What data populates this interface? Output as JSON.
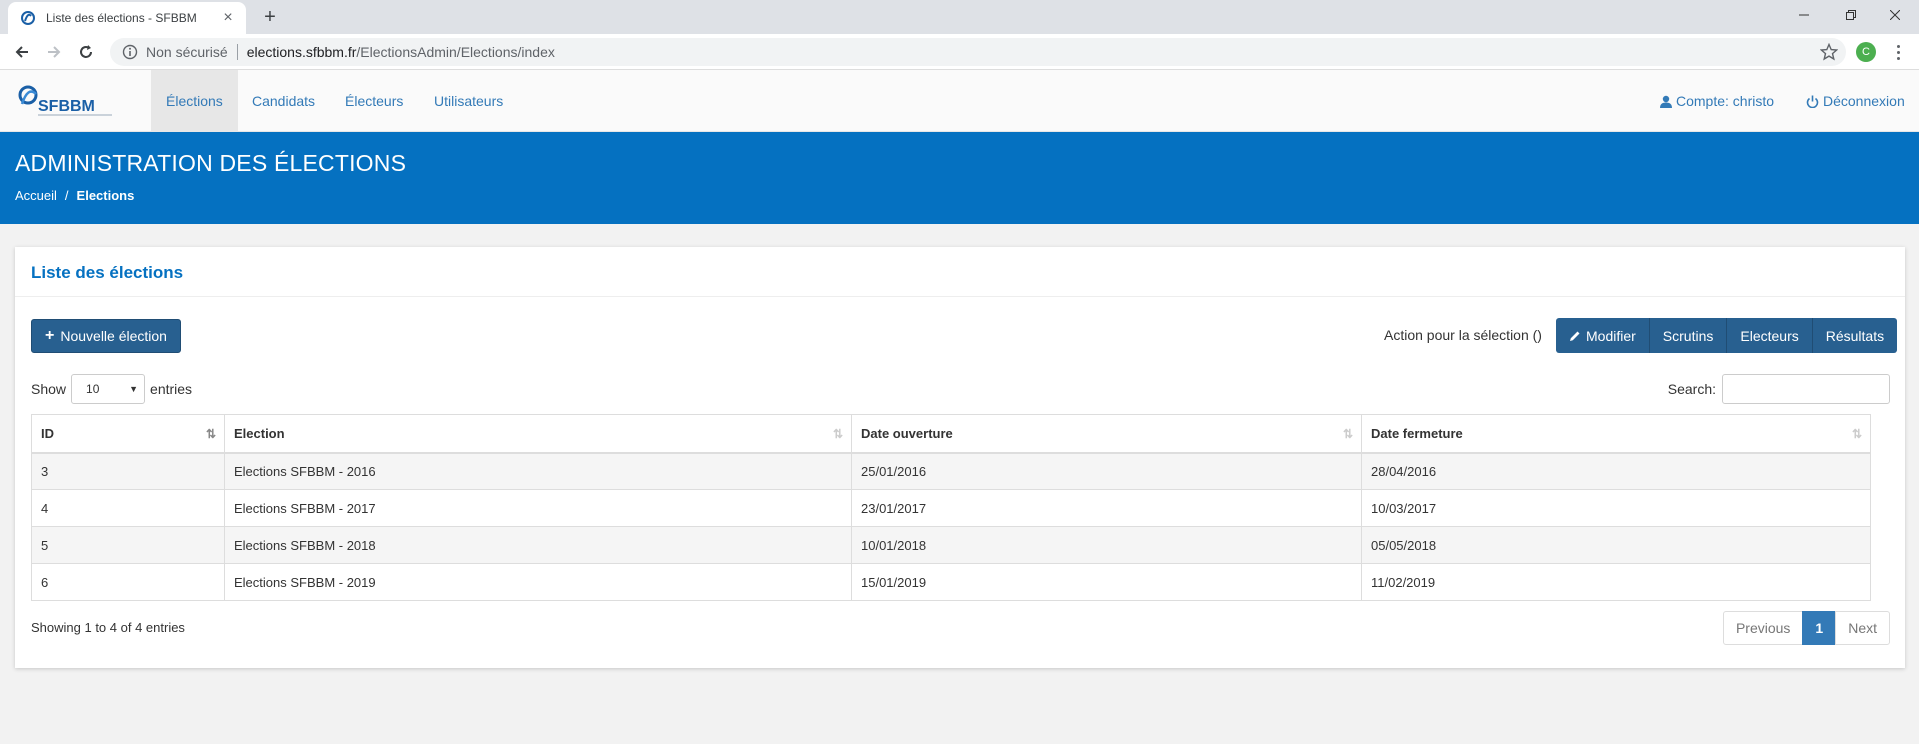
{
  "browser": {
    "tab_title": "Liste des élections - SFBBM",
    "new_tab": "+",
    "url_insecure_label": "Non sécurisé",
    "url_host": "elections.sfbbm.fr",
    "url_path": "/ElectionsAdmin/Elections/index",
    "profile_initial": "C"
  },
  "brand": {
    "logo_text": "SFBBM"
  },
  "nav": {
    "items": [
      {
        "label": "Élections",
        "active": true
      },
      {
        "label": "Candidats"
      },
      {
        "label": "Électeurs"
      },
      {
        "label": "Utilisateurs"
      }
    ],
    "account": "Compte: christo",
    "logout": "Déconnexion"
  },
  "banner": {
    "title": "ADMINISTRATION DES ÉLECTIONS",
    "breadcrumb": {
      "home": "Accueil",
      "separator": "/",
      "current": "Elections"
    }
  },
  "panel": {
    "title": "Liste des élections",
    "new_button": "Nouvelle élection",
    "action_label": "Action pour la sélection ()",
    "actions": [
      "Modifier",
      "Scrutins",
      "Electeurs",
      "Résultats"
    ]
  },
  "table_controls": {
    "show_label": "Show",
    "page_length": "10",
    "entries_label": "entries",
    "search_label": "Search:",
    "search_value": ""
  },
  "table": {
    "columns": [
      "ID",
      "Election",
      "Date ouverture",
      "Date fermeture"
    ],
    "rows": [
      [
        "3",
        "Elections SFBBM - 2016",
        "25/01/2016",
        "28/04/2016"
      ],
      [
        "4",
        "Elections SFBBM - 2017",
        "23/01/2017",
        "10/03/2017"
      ],
      [
        "5",
        "Elections SFBBM - 2018",
        "10/01/2018",
        "05/05/2018"
      ],
      [
        "6",
        "Elections SFBBM - 2019",
        "15/01/2019",
        "11/02/2019"
      ]
    ]
  },
  "footer": {
    "info": "Showing 1 to 4 of 4 entries",
    "previous": "Previous",
    "current_page": "1",
    "next": "Next"
  },
  "colors": {
    "primary": "#0571c1",
    "button": "#286090",
    "link": "#337ab7"
  }
}
